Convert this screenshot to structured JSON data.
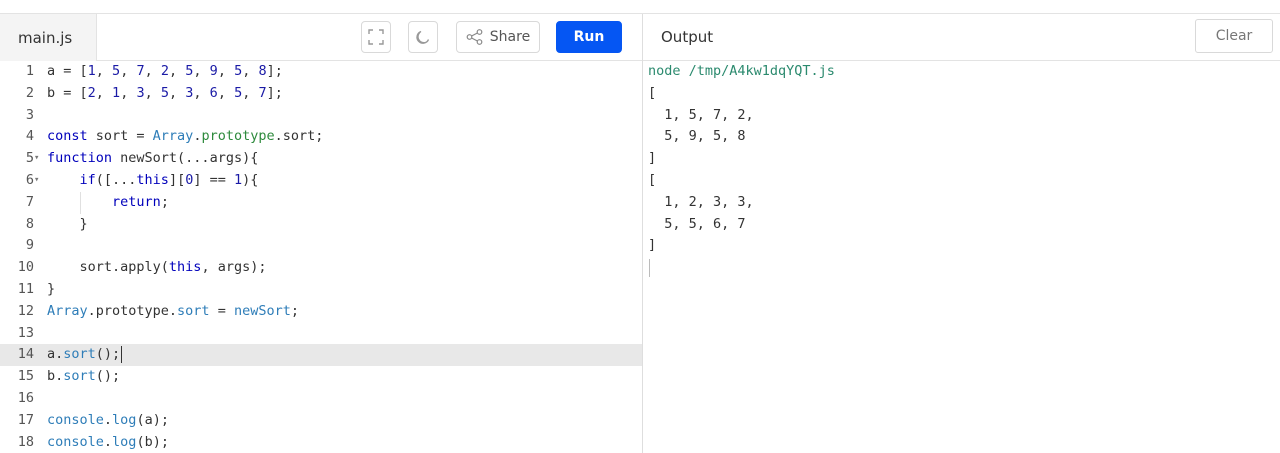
{
  "editor": {
    "file_tab": "main.js",
    "toolbar": {
      "fullscreen_icon": "fullscreen-icon",
      "theme_icon": "moon-icon",
      "share_label": "Share",
      "run_label": "Run"
    },
    "line_numbers": [
      "1",
      "2",
      "3",
      "4",
      "5",
      "6",
      "7",
      "8",
      "9",
      "10",
      "11",
      "12",
      "13",
      "14",
      "15",
      "16",
      "17",
      "18"
    ],
    "active_line": 14
  },
  "output": {
    "title": "Output",
    "clear_label": "Clear",
    "lines": [
      "node /tmp/A4kw1dqYQT.js",
      "[",
      "  1, 5, 7, 2,",
      "  5, 9, 5, 8",
      "]",
      "[",
      "  1, 2, 3, 3,",
      "  5, 5, 6, 7",
      "]"
    ]
  },
  "colors": {
    "run_button": "#0556f3",
    "active_line_bg": "#e8e8e8",
    "keyword": "#0000bb",
    "builtin": "#2e7db8",
    "prototype": "#2d8a3c",
    "command": "#2b8a6e"
  }
}
